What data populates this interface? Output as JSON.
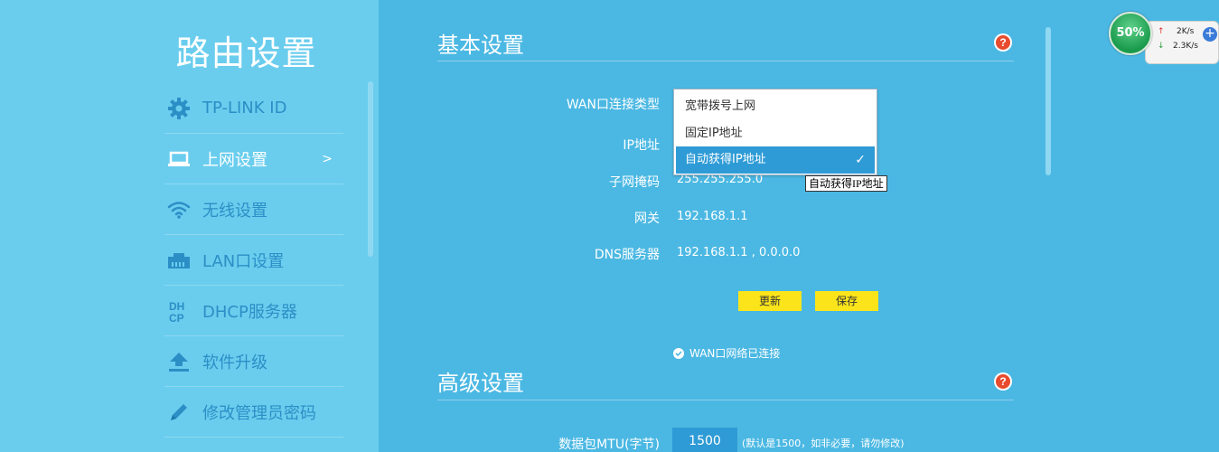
{
  "sidebar": {
    "title": "路由设置",
    "items": [
      {
        "label": "TP-LINK ID",
        "icon": "gear-icon"
      },
      {
        "label": "上网设置",
        "icon": "laptop-icon",
        "arrow": ">"
      },
      {
        "label": "无线设置",
        "icon": "wifi-icon"
      },
      {
        "label": "LAN口设置",
        "icon": "lan-port-icon"
      },
      {
        "label": "DHCP服务器",
        "icon": "dhcp-icon"
      },
      {
        "label": "软件升级",
        "icon": "upload-icon"
      },
      {
        "label": "修改管理员密码",
        "icon": "pencil-icon"
      }
    ]
  },
  "basic": {
    "title": "基本设置",
    "wan_type_label": "WAN口连接类型",
    "ip_label": "IP地址",
    "mask_label": "子网掩码",
    "mask_value": "255.255.255.0",
    "gateway_label": "网关",
    "gateway_value": "192.168.1.1",
    "dns_label": "DNS服务器",
    "dns_value": "192.168.1.1 , 0.0.0.0",
    "dropdown_options": [
      "宽带拨号上网",
      "固定IP地址",
      "自动获得IP地址"
    ],
    "selected_option": "自动获得IP地址",
    "tooltip": "自动获得IP地址",
    "refresh_button": "更新",
    "save_button": "保存",
    "status": "WAN口网络已连接"
  },
  "advanced": {
    "title": "高级设置",
    "mtu_label": "数据包MTU(字节)",
    "mtu_value": "1500",
    "mtu_hint": "(默认是1500，如非必要，请勿修改)"
  },
  "net_widget": {
    "percent": "50%",
    "up": "2K/s",
    "down": "2.3K/s"
  },
  "colors": {
    "main_bg": "#4bb8e3",
    "sidebar_bg": "#6acdee",
    "menu_text": "#2b8fc6",
    "button_yellow": "#fbe51a",
    "selected_blue": "#2e9bd6"
  }
}
